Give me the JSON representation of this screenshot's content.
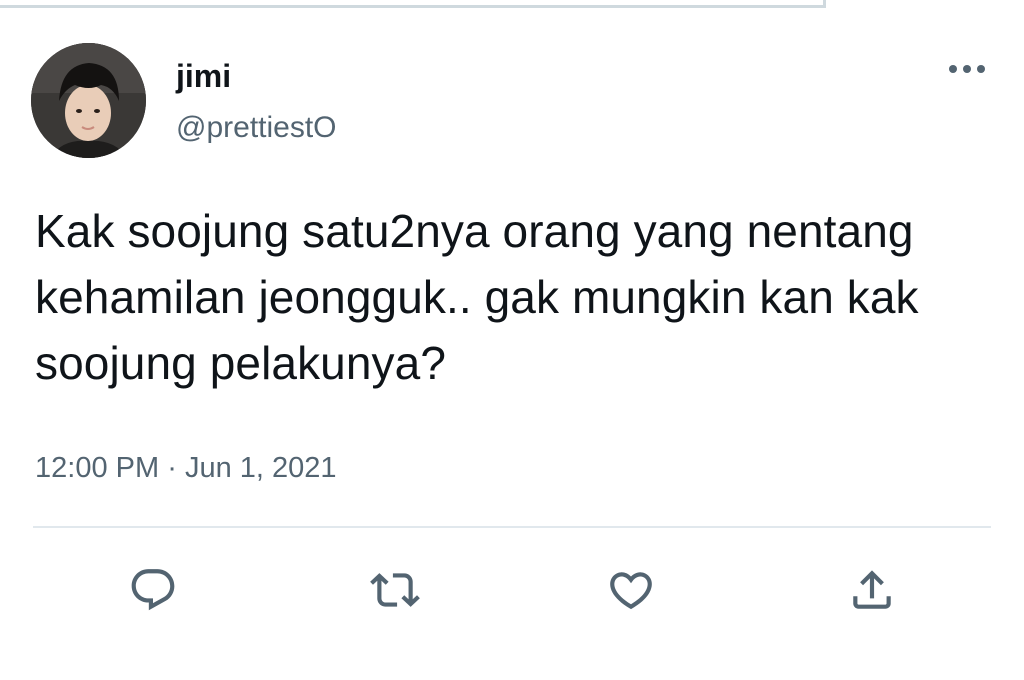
{
  "tweet": {
    "author": {
      "display_name": "jimi",
      "handle": "@prettiestO",
      "avatar_icon": "profile-photo"
    },
    "text": "Kak soojung satu2nya orang yang nentang kehamilan jeongguk.. gak mungkin kan kak soojung pelakunya?",
    "time": "12:00 PM",
    "separator": "·",
    "date": "Jun 1, 2021"
  },
  "actions": {
    "reply_icon": "reply-icon",
    "retweet_icon": "retweet-icon",
    "like_icon": "heart-icon",
    "share_icon": "share-icon",
    "more_icon": "more-horizontal-icon",
    "icon_color": "#536471"
  },
  "colors": {
    "text_primary": "#0f1419",
    "text_secondary": "#536471",
    "divider": "#e1e8ed"
  }
}
